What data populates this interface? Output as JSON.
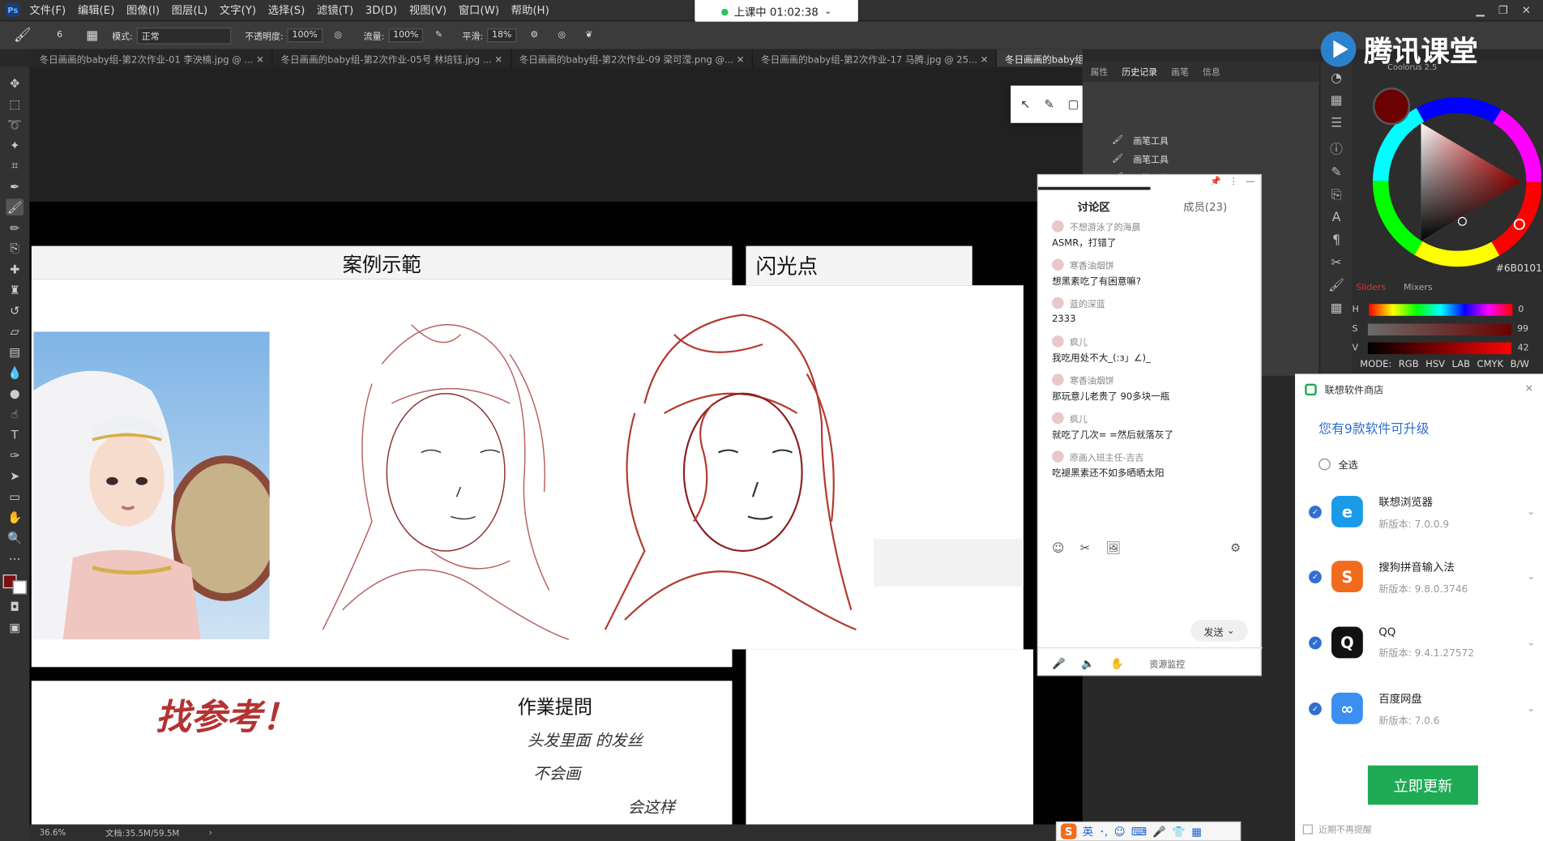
{
  "menubar": {
    "logo": "Ps",
    "items": [
      "文件(F)",
      "编辑(E)",
      "图像(I)",
      "图层(L)",
      "文字(Y)",
      "选择(S)",
      "滤镜(T)",
      "3D(D)",
      "视图(V)",
      "窗口(W)",
      "帮助(H)"
    ]
  },
  "timer": {
    "text": "上课中 01:02:38"
  },
  "options": {
    "size": "6",
    "mode_label": "模式:",
    "mode": "正常",
    "opacity_label": "不透明度:",
    "opacity": "100%",
    "flow_label": "流量:",
    "flow": "100%",
    "smooth_label": "平滑:",
    "smooth": "18%"
  },
  "tabs": [
    "冬日画画的baby组-第2次作业-01 李泱楠.jpg @ ...",
    "冬日画画的baby组-第2次作业-05号 林培钰.jpg ...",
    "冬日画画的baby组-第2次作业-09 梁可滢.png @...",
    "冬日画画的baby组-第2次作业-17 马腾.jpg @ 25...",
    "冬日画画的baby组-第2次作业-21 ..."
  ],
  "canvas": {
    "case_title": "案例示範",
    "flash_title": "闪光点",
    "handwritten_big": "找参考！",
    "homework_title": "作業提問",
    "homework_lines": [
      "头发里面 的发丝",
      "不会画",
      "会这样"
    ]
  },
  "status": {
    "zoom": "36.6%",
    "doc": "文档:35.5M/59.5M"
  },
  "history": {
    "tabs": [
      "属性",
      "历史记录",
      "画笔",
      "信息"
    ],
    "rows": [
      "画笔工具",
      "画笔工具",
      "画笔工具"
    ]
  },
  "color": {
    "panel_name": "Coolorus 2.5",
    "hex": "#6B0101",
    "tabs": [
      "Sliders",
      "Mixers"
    ],
    "sliders": [
      {
        "label": "H",
        "value": "0"
      },
      {
        "label": "S",
        "value": "99"
      },
      {
        "label": "V",
        "value": "42"
      }
    ],
    "modes": [
      "MODE:",
      "RGB",
      "HSV",
      "LAB",
      "CMYK",
      "B/W"
    ],
    "accent": "#6b0101"
  },
  "brand": {
    "name": "腾讯课堂"
  },
  "chat": {
    "tab_discuss": "讨论区",
    "tab_members": "成员(23)",
    "messages": [
      {
        "name": "不想游泳了的海晨",
        "text": "ASMR，打错了"
      },
      {
        "name": "寒香油烟饼",
        "text": "想黑素吃了有困意嘛?"
      },
      {
        "name": "蓝的深蓝",
        "text": "2333"
      },
      {
        "name": "疯儿",
        "text": "我吃用处不大_(:з」∠)_"
      },
      {
        "name": "寒香油烟饼",
        "text": "那玩意儿老贵了 90多块一瓶"
      },
      {
        "name": "疯儿",
        "text": "就吃了几次= =然后就落灰了"
      },
      {
        "name": "原画入班主任-吉吉",
        "text": "吃褪黑素还不如多晒晒太阳"
      }
    ],
    "send": "发送",
    "monitor": "资源监控"
  },
  "lenovo": {
    "title": "联想软件商店",
    "headline": "您有9款软件可升级",
    "select_all": "全选",
    "apps": [
      {
        "name": "联想浏览器",
        "version": "新版本: 7.0.0.9",
        "color": "#1a9be8",
        "glyph": "e"
      },
      {
        "name": "搜狗拼音输入法",
        "version": "新版本: 9.8.0.3746",
        "color": "#f26b1d",
        "glyph": "S"
      },
      {
        "name": "QQ",
        "version": "新版本: 9.4.1.27572",
        "color": "#111111",
        "glyph": "Q"
      },
      {
        "name": "百度网盘",
        "version": "新版本: 7.0.6",
        "color": "#3b8ff0",
        "glyph": "∞"
      }
    ],
    "button": "立即更新",
    "no_remind": "近期不再提醒"
  },
  "ime": {
    "label": "英"
  }
}
